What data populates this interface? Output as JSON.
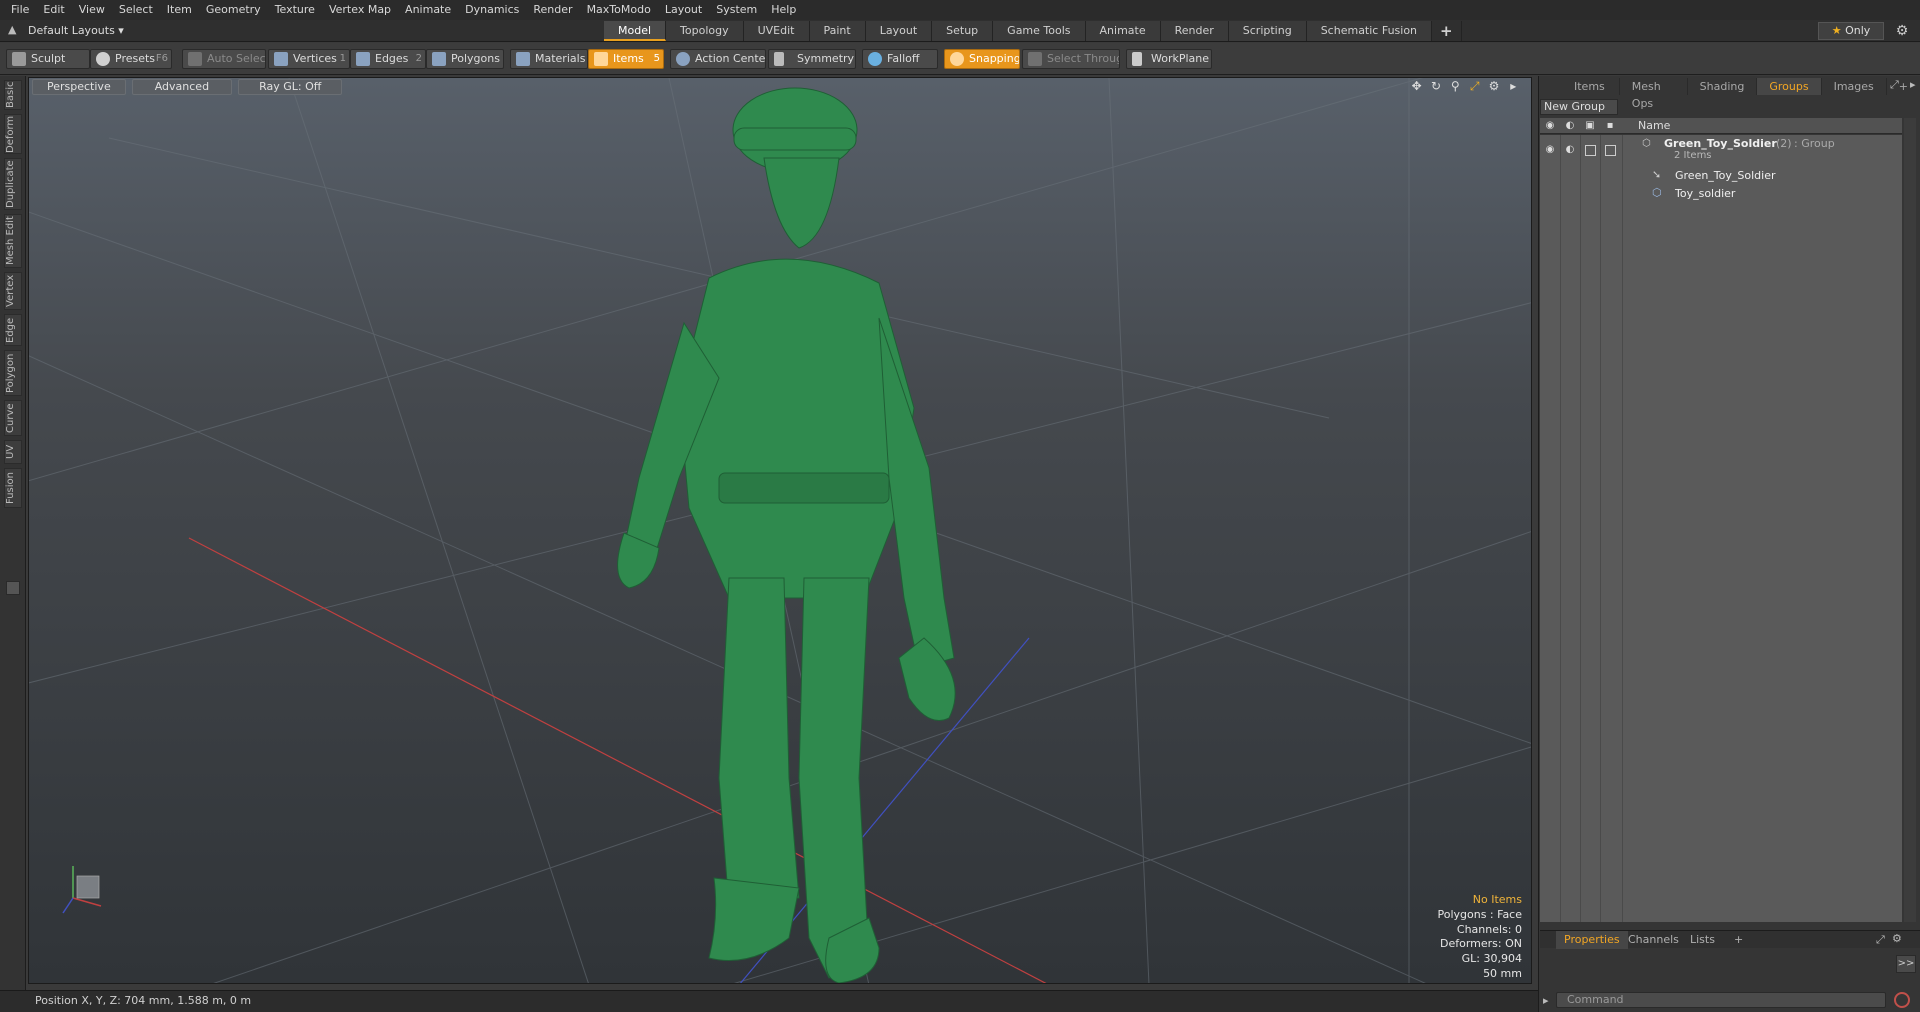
{
  "menu": [
    "File",
    "Edit",
    "View",
    "Select",
    "Item",
    "Geometry",
    "Texture",
    "Vertex Map",
    "Animate",
    "Dynamics",
    "Render",
    "MaxToModo",
    "Layout",
    "System",
    "Help"
  ],
  "layout_selector": "Default Layouts ▾",
  "mode_tabs": [
    "Model",
    "Topology",
    "UVEdit",
    "Paint",
    "Layout",
    "Setup",
    "Game Tools",
    "Animate",
    "Render",
    "Scripting",
    "Schematic Fusion"
  ],
  "active_mode_tab": "Model",
  "add_tab": "+",
  "only_button": "Only",
  "toolbar": {
    "sculpt": "Sculpt",
    "presets": "Presets",
    "presets_key": "F6",
    "auto_select": "Auto Select",
    "vertices": "Vertices",
    "vertices_count": "1",
    "edges": "Edges",
    "edges_count": "2",
    "polygons": "Polygons",
    "materials": "Materials",
    "items": "Items",
    "items_count": "5",
    "action_center": "Action Center",
    "symmetry": "Symmetry",
    "falloff": "Falloff",
    "snapping": "Snapping",
    "select_through": "Select Through",
    "workplane": "WorkPlane"
  },
  "left_tabs": [
    "Basic",
    "Deform",
    "Duplicate",
    "Mesh Edit",
    "Vertex",
    "Edge",
    "Polygon",
    "Curve",
    "UV",
    "Fusion"
  ],
  "viewport": {
    "view_mode": "Perspective",
    "shading": "Advanced",
    "raygl": "Ray GL: Off",
    "info": {
      "items": "No Items",
      "polygons": "Polygons : Face",
      "channels": "Channels: 0",
      "deformers": "Deformers: ON",
      "gl": "GL: 30,904",
      "scale": "50 mm"
    }
  },
  "status": "Position X, Y, Z:   704 mm, 1.588 m, 0 m",
  "right_panel": {
    "tabs": [
      "Items",
      "Mesh Ops",
      "Shading",
      "Groups",
      "Images"
    ],
    "active_tab": "Groups",
    "add_tab": "+",
    "new_group": "New Group",
    "column_name": "Name",
    "tree": {
      "group_name": "Green_Toy_Soldier",
      "group_count": "(2)",
      "group_type": ": Group",
      "group_items": "2 Items",
      "children": [
        "Green_Toy_Soldier",
        "Toy_soldier"
      ]
    },
    "bottom_tabs": [
      "Properties",
      "Channels",
      "Lists"
    ],
    "active_bottom_tab": "Properties",
    "bottom_add": "+",
    "expand": ">>",
    "command_placeholder": "Command"
  },
  "colors": {
    "accent": "#e8961c",
    "soldier": "#2f8a4e"
  }
}
